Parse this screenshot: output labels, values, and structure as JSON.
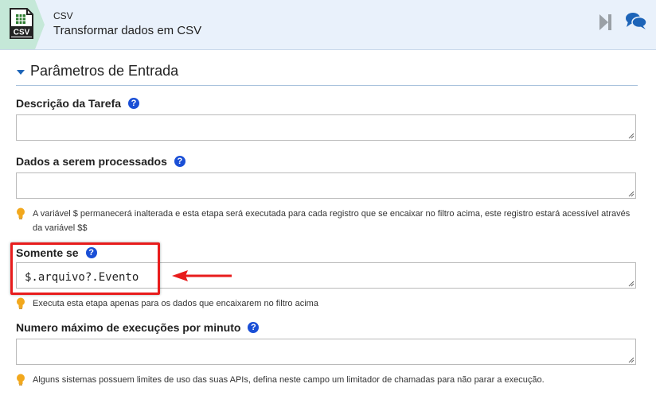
{
  "header": {
    "icon": "csv-file-icon",
    "icon_label": "CSV",
    "app_name": "CSV",
    "subtitle": "Transformar dados em CSV",
    "actions": [
      "skip-to-end-icon",
      "chat-icon"
    ]
  },
  "section": {
    "title": "Parâmetros de Entrada"
  },
  "fields": {
    "task_description": {
      "label": "Descrição da Tarefa",
      "value": ""
    },
    "data_to_process": {
      "label": "Dados a serem processados",
      "value": "",
      "hint": "A variável $ permanecerá inalterada e esta etapa será executada para cada registro que se encaixar no filtro acima, este registro estará acessível através da variável $$"
    },
    "only_if": {
      "label": "Somente se",
      "value": "$.arquivo?.Evento",
      "hint": "Executa esta etapa apenas para os dados que encaixarem no filtro acima"
    },
    "max_executions": {
      "label": "Numero máximo de execuções por minuto",
      "value": "",
      "hint": "Alguns sistemas possuem limites de uso das suas APIs, defina neste campo um limitador de chamadas para não parar a execução."
    }
  },
  "help_glyph": "?",
  "colors": {
    "header_bg": "#e9f1fb",
    "icon_tab_bg": "#c5e8d8",
    "help_blue": "#1a4fd6",
    "highlight_red": "#e81c1c",
    "hint_bulb": "#f2a81d"
  }
}
